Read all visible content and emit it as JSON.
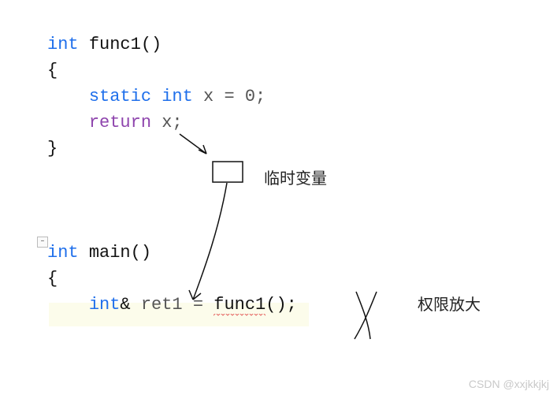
{
  "code": {
    "l1_type": "int",
    "l1_func": "func1",
    "l1_parens": "()",
    "l2_brace": "{",
    "l3_storage": "static",
    "l3_type": "int",
    "l3_rest": " x = 0;",
    "l4_return": "return",
    "l4_rest": " x;",
    "l5_brace": "}",
    "l6_type": "int",
    "l6_func": "main",
    "l6_parens": "()",
    "l7_brace": "{",
    "l8_type": "int",
    "l8_amp": "&",
    "l8_var": " ret1 = ",
    "l8_call": "func1",
    "l8_end": "();"
  },
  "annotations": {
    "temp_var": "临时变量",
    "perm_enlarge": "权限放大"
  },
  "collapse_glyph": "-",
  "watermark": "CSDN @xxjkkjkj"
}
